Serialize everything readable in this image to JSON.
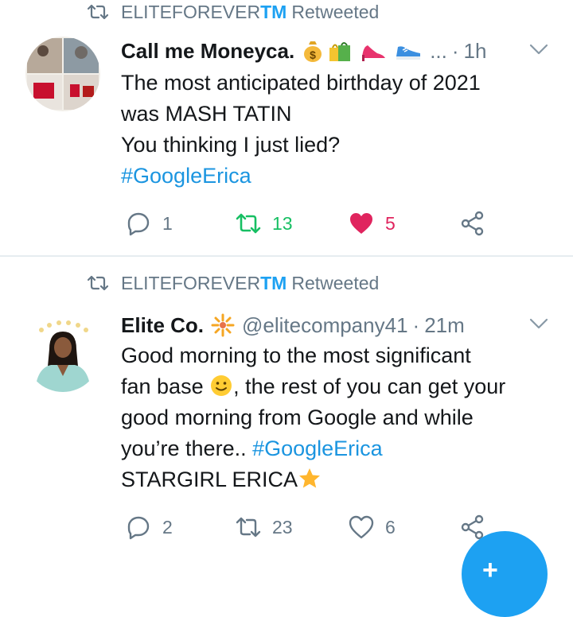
{
  "tweets": [
    {
      "retweeter_prefix": "ELITEFOREVER",
      "retweeter_suffix": "TM",
      "retweeted_label": "Retweeted",
      "author_name": "Call me Moneyca.",
      "author_emoji": [
        "money-bag",
        "shopping-bags",
        "high-heel",
        "sneaker"
      ],
      "ellipsis": "...",
      "separator": "·",
      "time": "1h",
      "text_lines": [
        "The most anticipated birthday of 2021",
        "was MASH TATIN",
        "You thinking I just lied?"
      ],
      "hashtag_line": "#GoogleErica",
      "counts": {
        "replies": "1",
        "retweets": "13",
        "likes": "5"
      },
      "retweeted": true,
      "liked": true
    },
    {
      "retweeter_prefix": "ELITEFOREVER",
      "retweeter_suffix": "TM",
      "retweeted_label": "Retweeted",
      "author_name": "Elite Co.",
      "author_emoji": [
        "sparkle-burst"
      ],
      "handle": "@elitecompany41",
      "separator": "·",
      "time": "21m",
      "text_line_1": "Good morning to the most significant",
      "text_line_2_a": "fan base ",
      "text_line_2_b": ", the rest of you can get your",
      "text_line_3": "good morning from Google and while",
      "text_line_4": "you’re there.. ",
      "hashtag": "#GoogleErica",
      "text_line_5": "STARGIRL ERICA",
      "counts": {
        "replies": "2",
        "retweets": "23",
        "likes": "6"
      },
      "retweeted": false,
      "liked": false
    }
  ],
  "compose_button": {
    "label": "+"
  },
  "colors": {
    "brand_blue": "#1da1f2",
    "retweet_green": "#17bf63",
    "like_red": "#e0245e",
    "muted_gray": "#657786"
  }
}
